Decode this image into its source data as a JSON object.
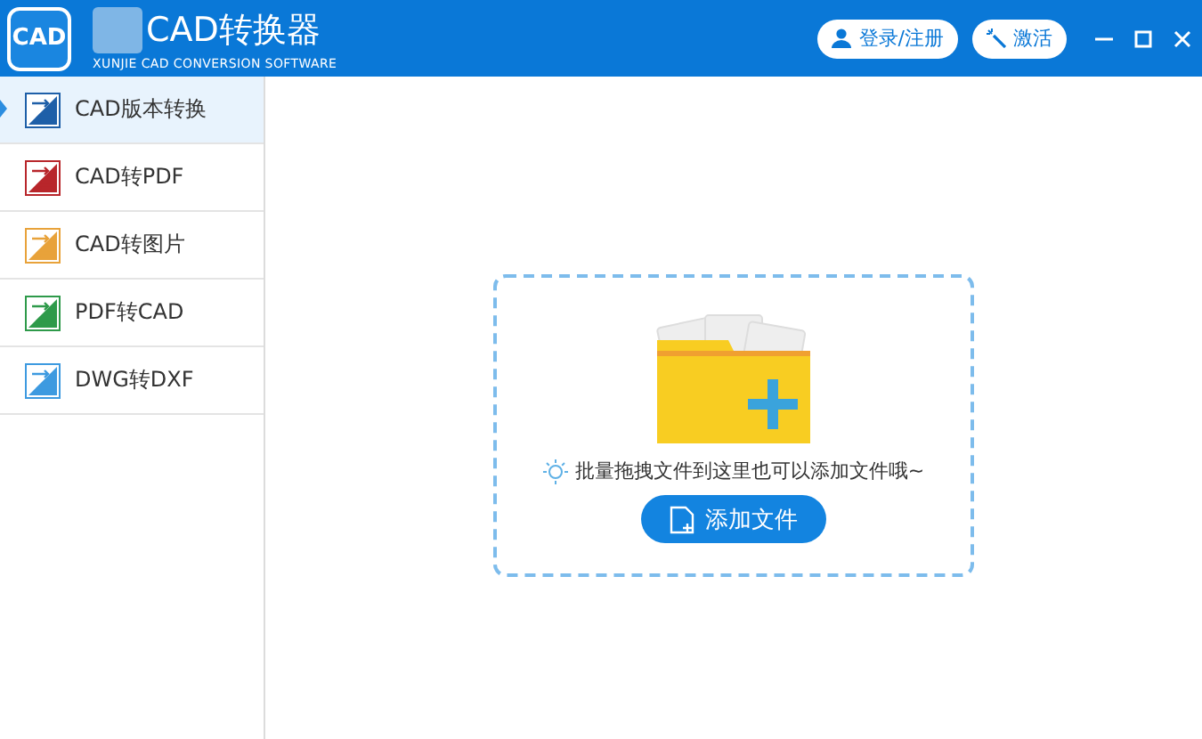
{
  "header": {
    "logo": "CAD",
    "title": "CAD转换器",
    "subtitle": "XUNJIE CAD CONVERSION SOFTWARE",
    "buttons": [
      {
        "kind": "user",
        "label": "登录/注册"
      },
      {
        "kind": "wand",
        "label": "激活"
      }
    ]
  },
  "sidebar": {
    "items": [
      {
        "label": "CAD版本转换",
        "selected": true,
        "color": "#1e5fa8"
      },
      {
        "label": "CAD转PDF",
        "selected": false,
        "color": "#b8262b"
      },
      {
        "label": "CAD转图片",
        "selected": false,
        "color": "#e8a23a"
      },
      {
        "label": "PDF转CAD",
        "selected": false,
        "color": "#2e9a4a"
      },
      {
        "label": "DWG转DXF",
        "selected": false,
        "color": "#3d9ae0"
      }
    ]
  },
  "dropzone": {
    "hint": "批量拖拽文件到这里也可以添加文件哦~",
    "button": "添加文件"
  }
}
